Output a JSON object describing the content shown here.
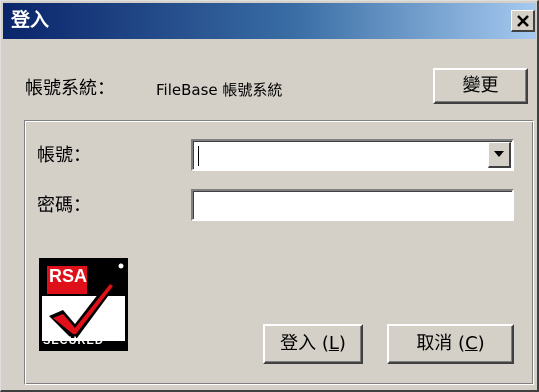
{
  "window": {
    "title": "登入"
  },
  "account_system": {
    "label": "帳號系統：",
    "value": "FileBase 帳號系統",
    "change_button": "變更"
  },
  "form": {
    "account_label": "帳號：",
    "account_value": "",
    "password_label": "密碼：",
    "password_value": ""
  },
  "logo": {
    "top_text": "RSA",
    "bottom_text": "SECURED"
  },
  "buttons": {
    "login": {
      "label": "登入 (",
      "mnemonic": "L",
      "suffix": ")"
    },
    "cancel": {
      "label": "取消 (",
      "mnemonic": "C",
      "suffix": ")"
    }
  },
  "icons": {
    "close": "close-icon",
    "dropdown": "chevron-down-icon"
  },
  "colors": {
    "title_bar_start": "#0a246a",
    "title_bar_end": "#a6caf0",
    "face": "#d4d0c8"
  }
}
